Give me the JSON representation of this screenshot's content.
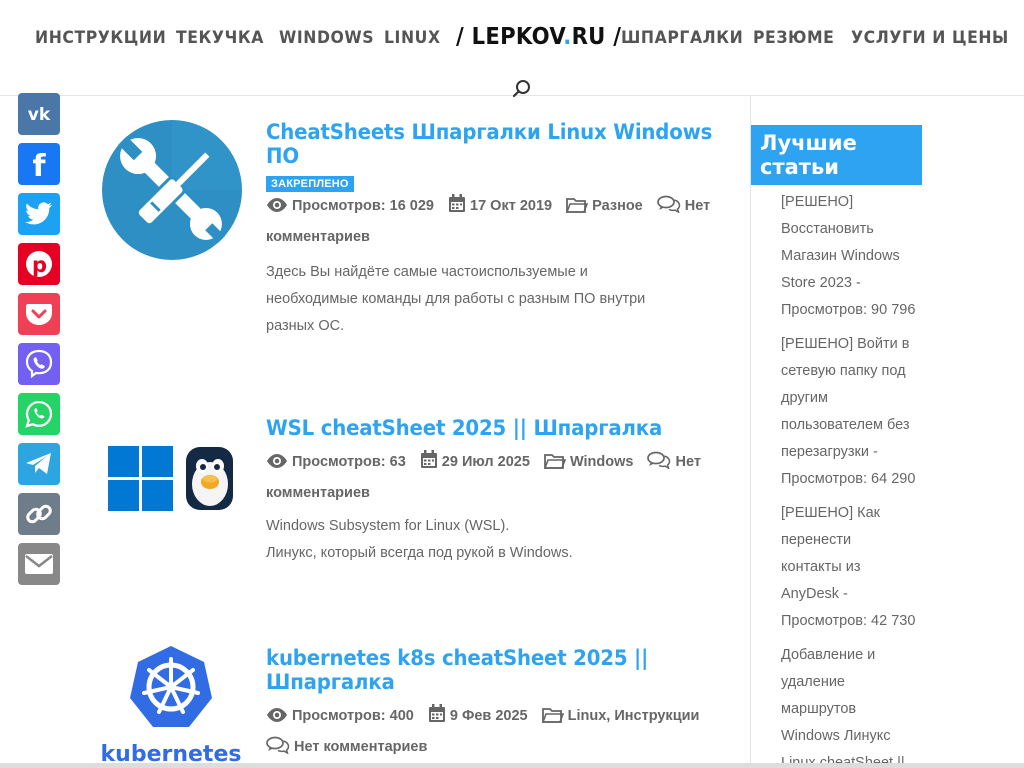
{
  "nav": {
    "items_left": [
      "ИНСТРУКЦИИ",
      "ТЕКУЧКА",
      "WINDOWS",
      "LINUX"
    ],
    "logo_prefix": "/ LEPKOV",
    "logo_dot": ".",
    "logo_suffix": "RU /",
    "items_right": [
      "ШПАРГАЛКИ",
      "РЕЗЮМЕ",
      "УСЛУГИ И ЦЕНЫ"
    ]
  },
  "social": [
    "vk-icon",
    "facebook-icon",
    "twitter-icon",
    "pinterest-icon",
    "pocket-icon",
    "viber-icon",
    "whatsapp-icon",
    "telegram-icon",
    "copy-link-icon",
    "email-icon"
  ],
  "posts": [
    {
      "title_line1": "CheatSheets Шпаргалки Linux Windows",
      "title_line2": "ПО",
      "badge": "ЗАКРЕПЛЕНО",
      "views": "Просмотров: 16 029",
      "date": "17 Окт 2019",
      "category": "Разное",
      "comments_a": "Нет",
      "comments_b": "комментариев",
      "excerpt_1": "Здесь Вы найдёте самые частоиспользуемые и",
      "excerpt_2": "необходимые команды для работы с разным ПО внутри",
      "excerpt_3": "разных ОС."
    },
    {
      "title_line1": "WSL cheatSheet 2025 || Шпаргалка",
      "views": "Просмотров: 63",
      "date": "29 Июл 2025",
      "category": "Windows",
      "comments_a": "Нет",
      "comments_b": "комментариев",
      "excerpt_1": "Windows Subsystem for Linux (WSL).",
      "excerpt_2": "Линукс, который всегда под рукой в Windows."
    },
    {
      "title_line1": "kubernetes k8s cheatSheet 2025 ||",
      "title_line2": "Шпаргалка",
      "views": "Просмотров: 400",
      "date": "9 Фев 2025",
      "category_1": "Linux",
      "category_sep": ", ",
      "category_2": "Инструкции",
      "comments": "Нет комментариев",
      "thumb_label": "kubernetes"
    }
  ],
  "sidebar": {
    "title_1": "Лучшие",
    "title_2": "статьи",
    "items": [
      [
        "[РЕШЕНО]",
        "Восстановить",
        "Магазин Windows",
        "Store 2023 -",
        "Просмотров: 90 796"
      ],
      [
        "[РЕШЕНО] Войти в",
        "сетевую папку под",
        "другим",
        "пользователем без",
        "перезагрузки -",
        "Просмотров: 64 290"
      ],
      [
        "[РЕШЕНО] Как",
        "перенести",
        "контакты из",
        "AnyDesk -",
        "Просмотров: 42 730"
      ],
      [
        "Добавление и",
        "удаление",
        "маршрутов",
        "Windows Линукс",
        "Linux cheatSheet ||"
      ]
    ]
  },
  "colors": {
    "accent": "#2ea3f2",
    "text": "#666666"
  }
}
